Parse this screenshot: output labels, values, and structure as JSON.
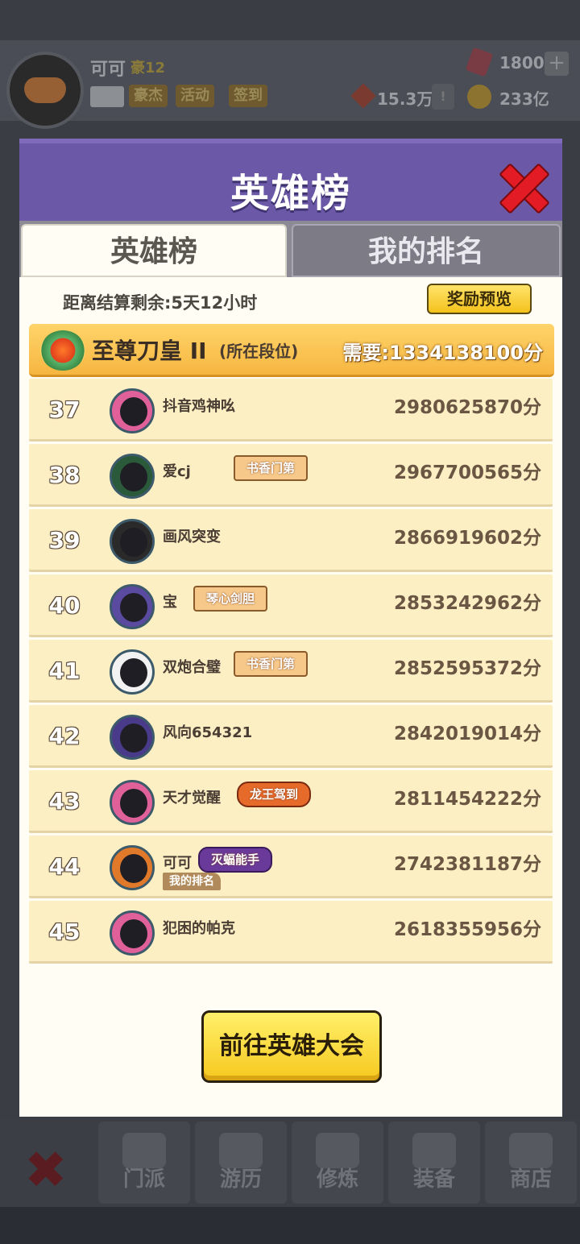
{
  "header": {
    "player_name": "可可",
    "player_rank": "豪12",
    "chips": [
      "豪杰",
      "活动",
      "签到"
    ],
    "gems": "1800",
    "power": "15.3万",
    "gold": "233亿"
  },
  "modal": {
    "title": "英雄榜",
    "tabs": [
      {
        "label": "英雄榜",
        "active": true
      },
      {
        "label": "我的排名",
        "active": false
      }
    ],
    "countdown": "距离结算剩余:5天12小时",
    "reward_preview": "奖励预览",
    "tier": {
      "name": "至尊刀皇 II",
      "note": "(所在段位)",
      "requirement": "需要:1334138100分"
    },
    "rows": [
      {
        "rank": "37",
        "name": "抖音鸡神吆",
        "badge": "",
        "score": "2980625870分",
        "avatar": "pink-ninja-avatar"
      },
      {
        "rank": "38",
        "name": "爱cj",
        "badge": "书香门第",
        "score": "2967700565分",
        "avatar": "green-ninja-avatar"
      },
      {
        "rank": "39",
        "name": "画风突变",
        "badge": "",
        "score": "2866919602分",
        "avatar": "black-ninja-avatar"
      },
      {
        "rank": "40",
        "name": "宝",
        "badge": "琴心剑胆",
        "score": "2853242962分",
        "avatar": "question-ninja-avatar"
      },
      {
        "rank": "41",
        "name": "双炮合璧",
        "badge": "书香门第",
        "score": "2852595372分",
        "avatar": "white-ninja-avatar"
      },
      {
        "rank": "42",
        "name": "风向654321",
        "badge": "",
        "score": "2842019014分",
        "avatar": "purple-ninja-avatar"
      },
      {
        "rank": "43",
        "name": "天才觉醒",
        "badge": "龙王驾到",
        "score": "2811454222分",
        "avatar": "pink-ninja-avatar"
      },
      {
        "rank": "44",
        "name": "可可",
        "badge": "灭蝠能手",
        "score": "2742381187分",
        "avatar": "orange-ninja-avatar",
        "my_rank_label": "我的排名"
      },
      {
        "rank": "45",
        "name": "犯困的帕克",
        "badge": "",
        "score": "2618355956分",
        "avatar": "pink-ninja-avatar"
      }
    ],
    "go_button": "前往英雄大会"
  },
  "nav": {
    "items": [
      "门派",
      "游历",
      "修炼",
      "装备",
      "商店"
    ]
  }
}
